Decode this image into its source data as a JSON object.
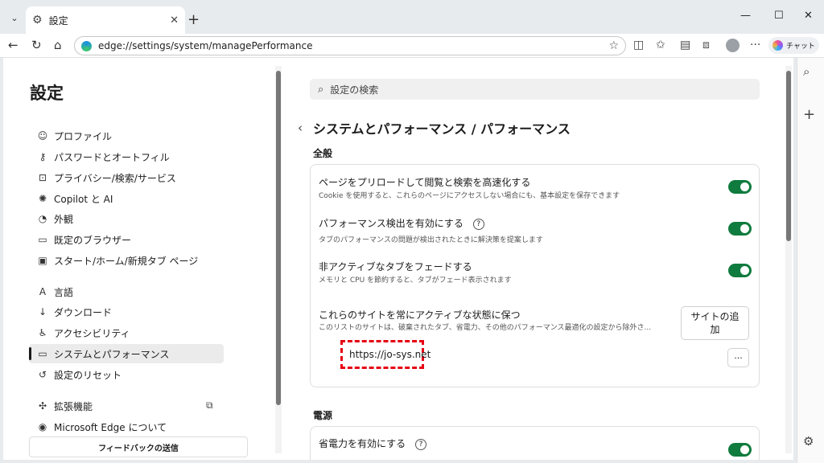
{
  "tab": {
    "title": "設定"
  },
  "address": {
    "url": "edge://settings/system/managePerformance"
  },
  "toolbar": {
    "chat_label": "チャット"
  },
  "sidebar": {
    "title": "設定",
    "items": [
      {
        "label": "プロファイル",
        "icon": "profile-icon"
      },
      {
        "label": "パスワードとオートフィル",
        "icon": "key-icon"
      },
      {
        "label": "プライバシー/検索/サービス",
        "icon": "lock-icon"
      },
      {
        "label": "Copilot と AI",
        "icon": "copilot-icon"
      },
      {
        "label": "外観",
        "icon": "palette-icon"
      },
      {
        "label": "既定のブラウザー",
        "icon": "browser-icon"
      },
      {
        "label": "スタート/ホーム/新規タブ ページ",
        "icon": "home-icon"
      },
      {
        "label": "言語",
        "icon": "language-icon"
      },
      {
        "label": "ダウンロード",
        "icon": "download-icon"
      },
      {
        "label": "アクセシビリティ",
        "icon": "accessibility-icon"
      },
      {
        "label": "システムとパフォーマンス",
        "icon": "laptop-icon"
      },
      {
        "label": "設定のリセット",
        "icon": "reset-icon"
      },
      {
        "label": "拡張機能",
        "icon": "puzzle-icon"
      },
      {
        "label": "Microsoft Edge について",
        "icon": "edge-icon"
      }
    ],
    "selected": "システムとパフォーマンス",
    "feedback": "フィードバックの送信"
  },
  "main": {
    "search_placeholder": "設定の検索",
    "page_title": "システムとパフォーマンス / パフォーマンス",
    "section_general": "全般",
    "rows": [
      {
        "title": "ページをプリロードして閲覧と検索を高速化する",
        "sub": "Cookie を使用すると、これらのページにアクセスしない場合にも、基本設定を保存できます",
        "on": true
      },
      {
        "title": "パフォーマンス検出を有効にする",
        "sub": "タブのパフォーマンスの問題が検出されたときに解決策を提案します",
        "on": true
      },
      {
        "title": "非アクティブなタブをフェードする",
        "sub": "メモリと CPU を節約すると、タブがフェード表示されます",
        "on": true
      }
    ],
    "always_active": {
      "title": "これらのサイトを常にアクティブな状態に保つ",
      "sub": "このリストのサイトは、破棄されたタブ、省電力、その他のパフォーマンス最適化の設定から除外さ...",
      "add_button": "サイトの追加",
      "site": "https://jo-sys.net",
      "more": "···"
    },
    "section_power": "電源",
    "power_row": {
      "title": "省電力を有効にする",
      "on": true
    }
  }
}
